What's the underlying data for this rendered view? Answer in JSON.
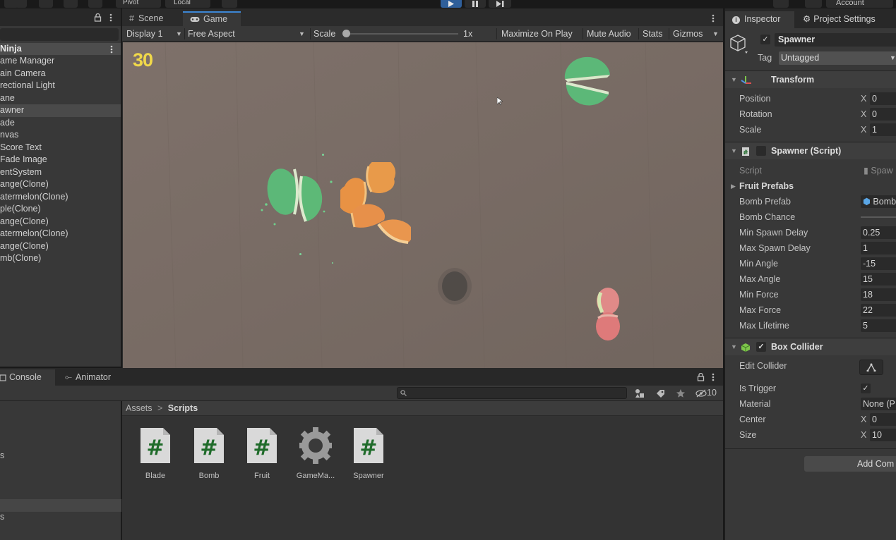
{
  "toolbar": {
    "pivot": "Pivot",
    "local": "Local",
    "account": "Account"
  },
  "hierarchy": {
    "scene_name": "Ninja",
    "items": [
      {
        "label": "ame Manager",
        "selected": false
      },
      {
        "label": "ain Camera",
        "selected": false
      },
      {
        "label": "rectional Light",
        "selected": false
      },
      {
        "label": "ane",
        "selected": false
      },
      {
        "label": "awner",
        "selected": true
      },
      {
        "label": "ade",
        "selected": false
      },
      {
        "label": "nvas",
        "selected": false
      },
      {
        "label": "Score Text",
        "selected": false
      },
      {
        "label": "Fade Image",
        "selected": false
      },
      {
        "label": "entSystem",
        "selected": false
      },
      {
        "label": "ange(Clone)",
        "selected": false
      },
      {
        "label": "atermelon(Clone)",
        "selected": false
      },
      {
        "label": "ple(Clone)",
        "selected": false
      },
      {
        "label": "ange(Clone)",
        "selected": false
      },
      {
        "label": "atermelon(Clone)",
        "selected": false
      },
      {
        "label": "ange(Clone)",
        "selected": false
      },
      {
        "label": "mb(Clone)",
        "selected": false
      }
    ]
  },
  "game": {
    "tabs": {
      "scene": "Scene",
      "game": "Game"
    },
    "display": "Display 1",
    "aspect": "Free Aspect",
    "scale_label": "Scale",
    "scale_value": "1x",
    "maximize": "Maximize On Play",
    "mute": "Mute Audio",
    "stats": "Stats",
    "gizmos": "Gizmos",
    "score": "30"
  },
  "bottom": {
    "tabs": {
      "console": "Console",
      "animator": "Animator"
    },
    "hidden_count": "10",
    "left_fragments": [
      "s",
      "s"
    ],
    "breadcrumb": {
      "root": "Assets",
      "sep": ">",
      "current": "Scripts"
    },
    "assets": [
      {
        "name": "Blade",
        "icon": "script-icon"
      },
      {
        "name": "Bomb",
        "icon": "script-icon"
      },
      {
        "name": "Fruit",
        "icon": "script-icon"
      },
      {
        "name": "GameMa...",
        "icon": "gear-icon"
      },
      {
        "name": "Spawner",
        "icon": "script-icon"
      }
    ]
  },
  "inspector": {
    "tabs": {
      "inspector": "Inspector",
      "project_settings": "Project Settings"
    },
    "object_name": "Spawner",
    "tag_label": "Tag",
    "tag_value": "Untagged",
    "transform": {
      "title": "Transform",
      "position_label": "Position",
      "position_x": "0",
      "rotation_label": "Rotation",
      "rotation_x": "0",
      "scale_label": "Scale",
      "scale_x": "1",
      "axis": "X"
    },
    "spawner": {
      "title": "Spawner (Script)",
      "script_label": "Script",
      "script_value": "Spaw",
      "fruit_prefabs": "Fruit Prefabs",
      "bomb_prefab_label": "Bomb Prefab",
      "bomb_prefab_value": "Bomb",
      "bomb_chance_label": "Bomb Chance",
      "fields": [
        {
          "label": "Min Spawn Delay",
          "value": "0.25"
        },
        {
          "label": "Max Spawn Delay",
          "value": "1"
        },
        {
          "label": "Min Angle",
          "value": "-15"
        },
        {
          "label": "Max Angle",
          "value": "15"
        },
        {
          "label": "Min Force",
          "value": "18"
        },
        {
          "label": "Max Force",
          "value": "22"
        },
        {
          "label": "Max Lifetime",
          "value": "5"
        }
      ]
    },
    "box_collider": {
      "title": "Box Collider",
      "edit_collider": "Edit Collider",
      "is_trigger": "Is Trigger",
      "material_label": "Material",
      "material_value": "None (P",
      "center_label": "Center",
      "center_x": "0",
      "size_label": "Size",
      "size_x": "10"
    },
    "add_component": "Add Com"
  },
  "colors": {
    "accent": "#3d87d5",
    "score": "#f0d84a",
    "script_green": "#1f6b2a",
    "play_blue": "#2f5f9a"
  }
}
